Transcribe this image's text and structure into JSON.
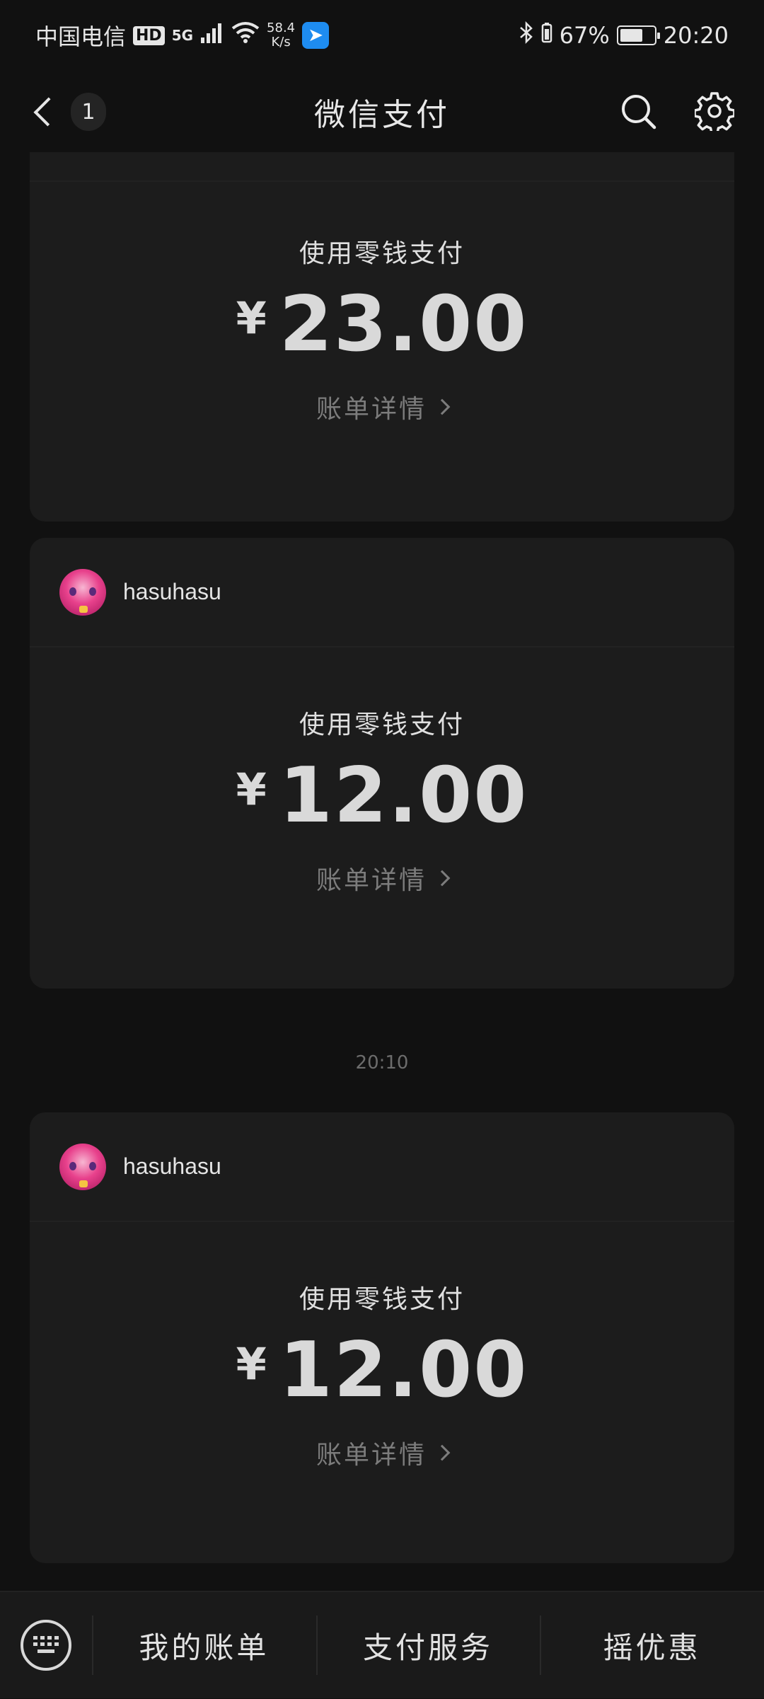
{
  "status_bar": {
    "carrier": "中国电信",
    "hd_badge": "HD",
    "network": "5G",
    "speed_value": "58.4",
    "speed_unit": "K/s",
    "battery_percent": "67%",
    "battery_level": 0.67,
    "time": "20:20"
  },
  "nav": {
    "back_count": "1",
    "title": "微信支付",
    "search_icon": "search-icon",
    "settings_icon": "gear-icon"
  },
  "transactions": [
    {
      "payer": "",
      "pay_method": "使用零钱支付",
      "currency": "¥",
      "amount": "23.00",
      "detail_label": "账单详情"
    },
    {
      "payer": "hasuhasu",
      "pay_method": "使用零钱支付",
      "currency": "¥",
      "amount": "12.00",
      "detail_label": "账单详情"
    },
    {
      "payer": "hasuhasu",
      "pay_method": "使用零钱支付",
      "currency": "¥",
      "amount": "12.00",
      "detail_label": "账单详情"
    }
  ],
  "time_separator": "20:10",
  "bottom_menu": {
    "keyboard_icon": "keyboard-icon",
    "items": [
      "我的账单",
      "支付服务",
      "摇优惠"
    ]
  }
}
